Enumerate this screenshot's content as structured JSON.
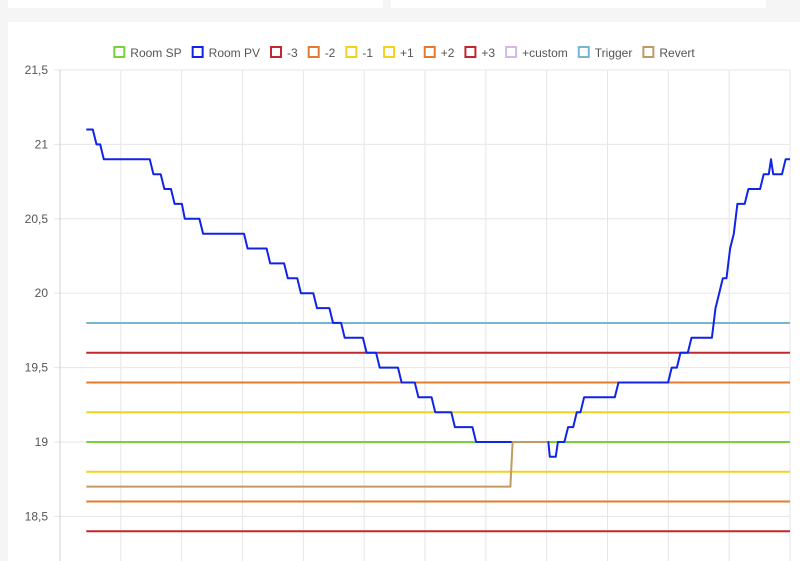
{
  "chart_data": {
    "type": "line",
    "ylim": [
      18.2,
      21.5
    ],
    "xlim": [
      0,
      100
    ],
    "grid": true,
    "legend_position": "top",
    "y_ticks": [
      {
        "value": 21.5,
        "label": "21,5"
      },
      {
        "value": 21,
        "label": "21"
      },
      {
        "value": 20.5,
        "label": "20,5"
      },
      {
        "value": 20,
        "label": "20"
      },
      {
        "value": 19.5,
        "label": "19,5"
      },
      {
        "value": 19,
        "label": "19"
      },
      {
        "value": 18.5,
        "label": "18,5"
      }
    ],
    "series": [
      {
        "name": "Room SP",
        "color": "#7ad03a",
        "type": "hline",
        "value": 19.0
      },
      {
        "name": "Room PV",
        "color": "#1024e8",
        "type": "line",
        "points": [
          [
            3.6,
            21.1
          ],
          [
            4.5,
            21.1
          ],
          [
            5.0,
            21.0
          ],
          [
            5.5,
            21.0
          ],
          [
            6.0,
            20.9
          ],
          [
            12.3,
            20.9
          ],
          [
            12.8,
            20.8
          ],
          [
            13.8,
            20.8
          ],
          [
            14.3,
            20.7
          ],
          [
            15.2,
            20.7
          ],
          [
            15.7,
            20.6
          ],
          [
            16.7,
            20.6
          ],
          [
            17.1,
            20.5
          ],
          [
            19.1,
            20.5
          ],
          [
            19.6,
            20.4
          ],
          [
            25.2,
            20.4
          ],
          [
            25.7,
            20.3
          ],
          [
            28.3,
            20.3
          ],
          [
            28.8,
            20.2
          ],
          [
            30.7,
            20.2
          ],
          [
            31.2,
            20.1
          ],
          [
            32.5,
            20.1
          ],
          [
            33.0,
            20.0
          ],
          [
            34.7,
            20.0
          ],
          [
            35.2,
            19.9
          ],
          [
            36.9,
            19.9
          ],
          [
            37.4,
            19.8
          ],
          [
            38.5,
            19.8
          ],
          [
            39.0,
            19.7
          ],
          [
            41.5,
            19.7
          ],
          [
            42.0,
            19.6
          ],
          [
            43.3,
            19.6
          ],
          [
            43.8,
            19.5
          ],
          [
            46.3,
            19.5
          ],
          [
            46.8,
            19.4
          ],
          [
            48.6,
            19.4
          ],
          [
            49.1,
            19.3
          ],
          [
            50.9,
            19.3
          ],
          [
            51.4,
            19.2
          ],
          [
            53.6,
            19.2
          ],
          [
            54.1,
            19.1
          ],
          [
            56.5,
            19.1
          ],
          [
            57.0,
            19.0
          ],
          [
            66.9,
            19.0
          ],
          [
            67.1,
            18.9
          ],
          [
            67.9,
            18.9
          ],
          [
            68.2,
            19.0
          ],
          [
            69.1,
            19.0
          ],
          [
            69.6,
            19.1
          ],
          [
            70.3,
            19.1
          ],
          [
            70.8,
            19.2
          ],
          [
            71.3,
            19.2
          ],
          [
            71.8,
            19.3
          ],
          [
            76.0,
            19.3
          ],
          [
            76.5,
            19.4
          ],
          [
            83.3,
            19.4
          ],
          [
            83.8,
            19.5
          ],
          [
            84.5,
            19.5
          ],
          [
            85.0,
            19.6
          ],
          [
            86.0,
            19.6
          ],
          [
            86.5,
            19.7
          ],
          [
            89.3,
            19.7
          ],
          [
            89.8,
            19.9
          ],
          [
            90.3,
            20.0
          ],
          [
            90.8,
            20.1
          ],
          [
            91.3,
            20.1
          ],
          [
            91.8,
            20.3
          ],
          [
            92.3,
            20.4
          ],
          [
            92.8,
            20.6
          ],
          [
            93.8,
            20.6
          ],
          [
            94.3,
            20.7
          ],
          [
            95.9,
            20.7
          ],
          [
            96.4,
            20.8
          ],
          [
            97.1,
            20.8
          ],
          [
            97.4,
            20.9
          ],
          [
            97.7,
            20.8
          ],
          [
            98.9,
            20.8
          ],
          [
            99.4,
            20.9
          ],
          [
            100.0,
            20.9
          ]
        ]
      },
      {
        "name": "-3",
        "color": "#c0282d",
        "type": "hline",
        "value": 19.6
      },
      {
        "name": "-2",
        "color": "#e47b30",
        "type": "hline",
        "value": 19.4
      },
      {
        "name": "-1",
        "color": "#f3d21f",
        "type": "hline",
        "value": 19.2
      },
      {
        "name": "+1",
        "color": "#f3d21f",
        "type": "hline",
        "value": 18.8
      },
      {
        "name": "+2",
        "color": "#e47b30",
        "type": "hline",
        "value": 18.6
      },
      {
        "name": "+3",
        "color": "#c0282d",
        "type": "hline",
        "value": 18.4
      },
      {
        "name": "+custom",
        "color": "#d5b8e3",
        "type": "none"
      },
      {
        "name": "Trigger",
        "color": "#7ab3d3",
        "type": "hline",
        "value": 19.8
      },
      {
        "name": "Revert",
        "color": "#c09a62",
        "type": "line",
        "points": [
          [
            3.6,
            18.7
          ],
          [
            61.7,
            18.7
          ],
          [
            62.0,
            19.0
          ],
          [
            66.8,
            19.0
          ]
        ]
      }
    ]
  }
}
